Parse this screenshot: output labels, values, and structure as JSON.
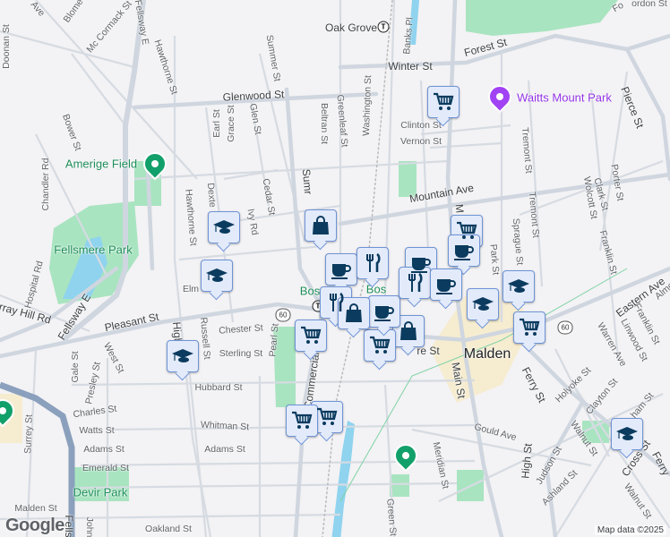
{
  "map": {
    "streets": {
      "ave_nw": "Ave",
      "blomer": "Blome",
      "mccormack": "Mc Cormack St",
      "doonan": "Doonan St",
      "fellsway_e_top": "Fellsway E",
      "hawthorne_n": "Hawthorne St",
      "summer_n": "Summer St",
      "glenwood": "Glenwood St",
      "earl": "Earl St",
      "grace": "Grace St",
      "glen": "Glen St",
      "beltran": "Beltran St",
      "greenleaf": "Greenleaf St",
      "washington": "Washington St",
      "banks": "Banks Pl",
      "winter": "Winter St",
      "forest": "Forest St",
      "clinton": "Clinton St",
      "vernon": "Vernon St",
      "pierce": "Pierce St",
      "tremont_n": "Tremont St",
      "tremont_s": "Tremont St",
      "porter": "Porter St",
      "clark": "Clark St",
      "wolcott": "Wolcott St",
      "franklin_n": "Franklin St",
      "sprague": "Sprague St",
      "park": "Park St",
      "mountain": "Mountain Ave",
      "main_n": "M",
      "bower": "Bower St",
      "chandler": "Chandler Rd",
      "hawthorne_s": "Hawthorne St",
      "dexter": "Dexte",
      "cedar": "Cedar St",
      "ivy": "Ivy Rd",
      "summer_s": "Sumr",
      "elm": "Elm",
      "hospital": "Hospital Rd",
      "murray_hill": "rray Hill Rd",
      "fellsway_e": "Fellsway E",
      "pleasant": "Pleasant St",
      "west": "West St",
      "gale": "Gale St",
      "presley": "Presley St",
      "high_n": "High",
      "russell": "Russell St",
      "chester": "Chester St",
      "pearl": "Pearl St",
      "sterling": "Sterling St",
      "hubbard": "Hubbard St",
      "charles": "Charles St",
      "watts": "Watts St",
      "whitman": "Whitman St",
      "adams_w": "Adams St",
      "adams_e": "Adams St",
      "emerald": "Emerald St",
      "surrey": "Surrey St",
      "malden_st": "Malden St",
      "commercial": "Commercial St",
      "centre": "re St",
      "main_s": "Main St",
      "ferry_n": "Ferry St",
      "ferry_s": "Ferry",
      "holyoke": "Holyoke St",
      "clayton": "Clayton St",
      "warren": "Warren Ave",
      "linwood": "Linwood St",
      "franklin_e": "Franklin St",
      "eastern": "Eastern Ave",
      "almont": "Almo",
      "gould": "Gould Ave",
      "meridian": "Meridian St",
      "high_s": "High St",
      "judson": "Judson St",
      "ashland": "Ashland St",
      "walnut_n": "Walnut St",
      "walnut_s": "Walnut St",
      "cross": "Cross St",
      "graham": "ham St",
      "green": "Green St",
      "john": "John",
      "fells_s": "Fells",
      "oakland": "Oakland St",
      "gordon": "ordon St",
      "forest_ne": "Fo"
    },
    "places": {
      "oak_grove": "Oak Grove",
      "waitts_mount_park": "Waitts Mount Park",
      "amerige_field": "Amerige Field",
      "fellsmere_park": "Fellsmere Park",
      "devir_park": "Devir Park",
      "malden": "Malden",
      "malden_center_station": "Bos",
      "malden_center_station_2": "Bos"
    },
    "route_shield": "60",
    "transit_symbol": "T",
    "markers": [
      {
        "type": "grocery"
      },
      {
        "type": "school"
      },
      {
        "type": "school"
      },
      {
        "type": "school"
      },
      {
        "type": "grocery"
      },
      {
        "type": "grocery"
      },
      {
        "type": "grocery"
      },
      {
        "type": "shopping"
      },
      {
        "type": "grocery"
      },
      {
        "type": "cafe"
      },
      {
        "type": "school"
      },
      {
        "type": "school"
      },
      {
        "type": "grocery"
      },
      {
        "type": "school"
      },
      {
        "type": "shopping"
      },
      {
        "type": "grocery"
      },
      {
        "type": "shopping"
      },
      {
        "type": "restaurant"
      },
      {
        "type": "cafe"
      },
      {
        "type": "restaurant"
      },
      {
        "type": "cafe"
      },
      {
        "type": "cafe"
      },
      {
        "type": "restaurant"
      },
      {
        "type": "grocery"
      },
      {
        "type": "cafe"
      }
    ],
    "colors": {
      "marker_fill": "#e3ebfb",
      "marker_border": "#6e93d6",
      "marker_icon": "#0b3b5e",
      "park": "#a8e4c0",
      "water": "#8fd3ef",
      "pin_green": "#12a06a",
      "pin_purple": "#a142f4",
      "highway": "#8aa0bd"
    }
  },
  "branding": {
    "logo": "Google",
    "attribution": "Map data ©2025"
  }
}
